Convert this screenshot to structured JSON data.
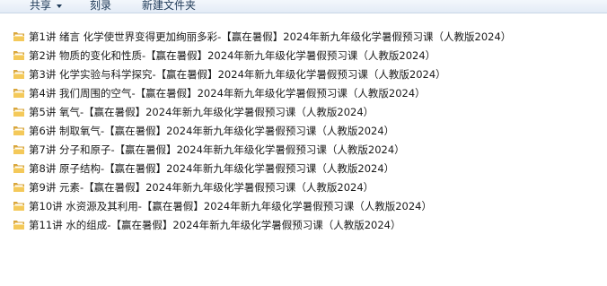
{
  "toolbar": {
    "share_label": "共享",
    "burn_label": "刻录",
    "new_folder_label": "新建文件夹"
  },
  "folder_icon": "folder-icon",
  "colors": {
    "folder_body": "#f4c95a",
    "folder_dark": "#d9a63a",
    "toolbar_text": "#1e3957"
  },
  "files": [
    {
      "name": "第1讲 绪言 化学使世界变得更加绚丽多彩-【赢在暑假】2024年新九年级化学暑假预习课（人教版2024）"
    },
    {
      "name": "第2讲 物质的变化和性质-【赢在暑假】2024年新九年级化学暑假预习课（人教版2024）"
    },
    {
      "name": "第3讲 化学实验与科学探究-【赢在暑假】2024年新九年级化学暑假预习课（人教版2024）"
    },
    {
      "name": "第4讲 我们周围的空气-【赢在暑假】2024年新九年级化学暑假预习课（人教版2024）"
    },
    {
      "name": "第5讲  氧气-【赢在暑假】2024年新九年级化学暑假预习课（人教版2024）"
    },
    {
      "name": "第6讲 制取氧气-【赢在暑假】2024年新九年级化学暑假预习课（人教版2024）"
    },
    {
      "name": "第7讲 分子和原子-【赢在暑假】2024年新九年级化学暑假预习课（人教版2024）"
    },
    {
      "name": "第8讲 原子结构-【赢在暑假】2024年新九年级化学暑假预习课（人教版2024）"
    },
    {
      "name": "第9讲 元素-【赢在暑假】2024年新九年级化学暑假预习课（人教版2024）"
    },
    {
      "name": "第10讲  水资源及其利用-【赢在暑假】2024年新九年级化学暑假预习课（人教版2024）"
    },
    {
      "name": "第11讲  水的组成-【赢在暑假】2024年新九年级化学暑假预习课（人教版2024）"
    }
  ]
}
